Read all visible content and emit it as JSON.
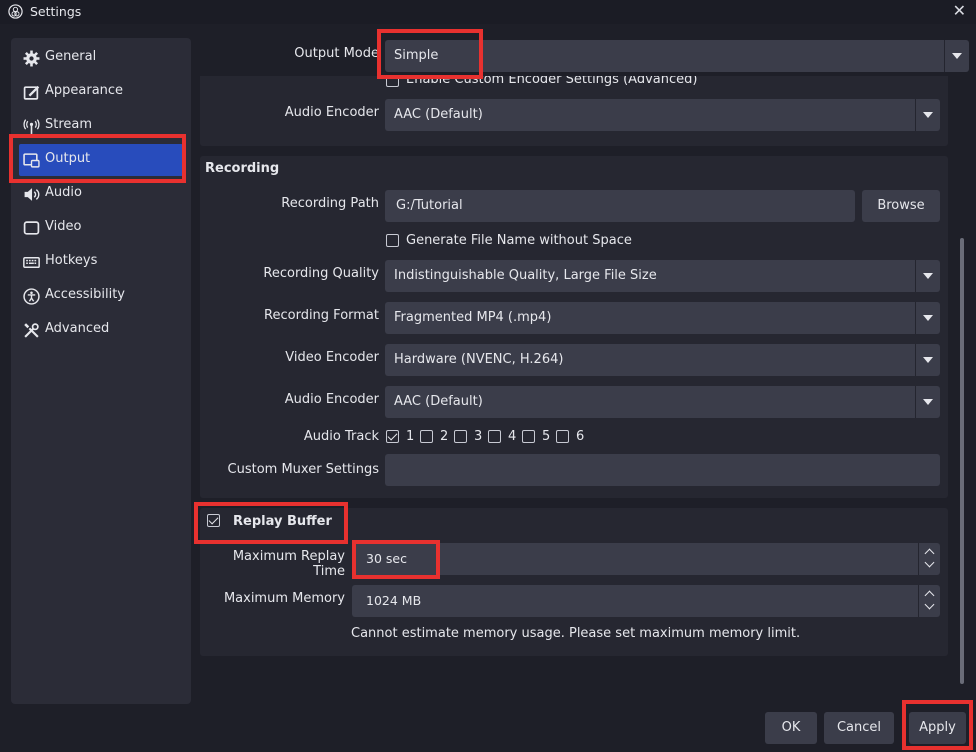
{
  "window": {
    "title": "Settings",
    "close_glyph": "✕"
  },
  "sidebar": {
    "items": [
      {
        "label": "General",
        "icon": "gear-icon"
      },
      {
        "label": "Appearance",
        "icon": "appearance-icon"
      },
      {
        "label": "Stream",
        "icon": "antenna-icon"
      },
      {
        "label": "Output",
        "icon": "output-icon"
      },
      {
        "label": "Audio",
        "icon": "speaker-icon"
      },
      {
        "label": "Video",
        "icon": "monitor-icon"
      },
      {
        "label": "Hotkeys",
        "icon": "keyboard-icon"
      },
      {
        "label": "Accessibility",
        "icon": "accessibility-icon"
      },
      {
        "label": "Advanced",
        "icon": "tools-icon"
      }
    ],
    "active": "Output"
  },
  "output_mode": {
    "label": "Output Mode",
    "value": "Simple"
  },
  "streaming": {
    "enable_custom_encoder_label": "Enable Custom Encoder Settings (Advanced)",
    "audio_encoder_label": "Audio Encoder",
    "audio_encoder_value": "AAC (Default)"
  },
  "recording": {
    "title": "Recording",
    "path_label": "Recording Path",
    "path_value": "G:/Tutorial",
    "browse_label": "Browse",
    "no_space_label": "Generate File Name without Space",
    "quality_label": "Recording Quality",
    "quality_value": "Indistinguishable Quality, Large File Size",
    "format_label": "Recording Format",
    "format_value": "Fragmented MP4 (.mp4)",
    "video_encoder_label": "Video Encoder",
    "video_encoder_value": "Hardware (NVENC, H.264)",
    "audio_encoder_label": "Audio Encoder",
    "audio_encoder_value": "AAC (Default)",
    "audio_track_label": "Audio Track",
    "tracks": [
      {
        "label": "1",
        "checked": true
      },
      {
        "label": "2",
        "checked": false
      },
      {
        "label": "3",
        "checked": false
      },
      {
        "label": "4",
        "checked": false
      },
      {
        "label": "5",
        "checked": false
      },
      {
        "label": "6",
        "checked": false
      }
    ],
    "muxer_label": "Custom Muxer Settings",
    "muxer_value": ""
  },
  "replay_buffer": {
    "title": "Replay Buffer",
    "enabled": true,
    "max_time_label": "Maximum Replay Time",
    "max_time_value": "30 sec",
    "max_memory_label": "Maximum Memory",
    "max_memory_value": "1024 MB",
    "memory_note": "Cannot estimate memory usage. Please set maximum memory limit."
  },
  "footer": {
    "ok_label": "OK",
    "cancel_label": "Cancel",
    "apply_label": "Apply"
  },
  "colors": {
    "highlight": "#e8312f",
    "accent": "#284cbc",
    "background": "#1e1f28"
  }
}
